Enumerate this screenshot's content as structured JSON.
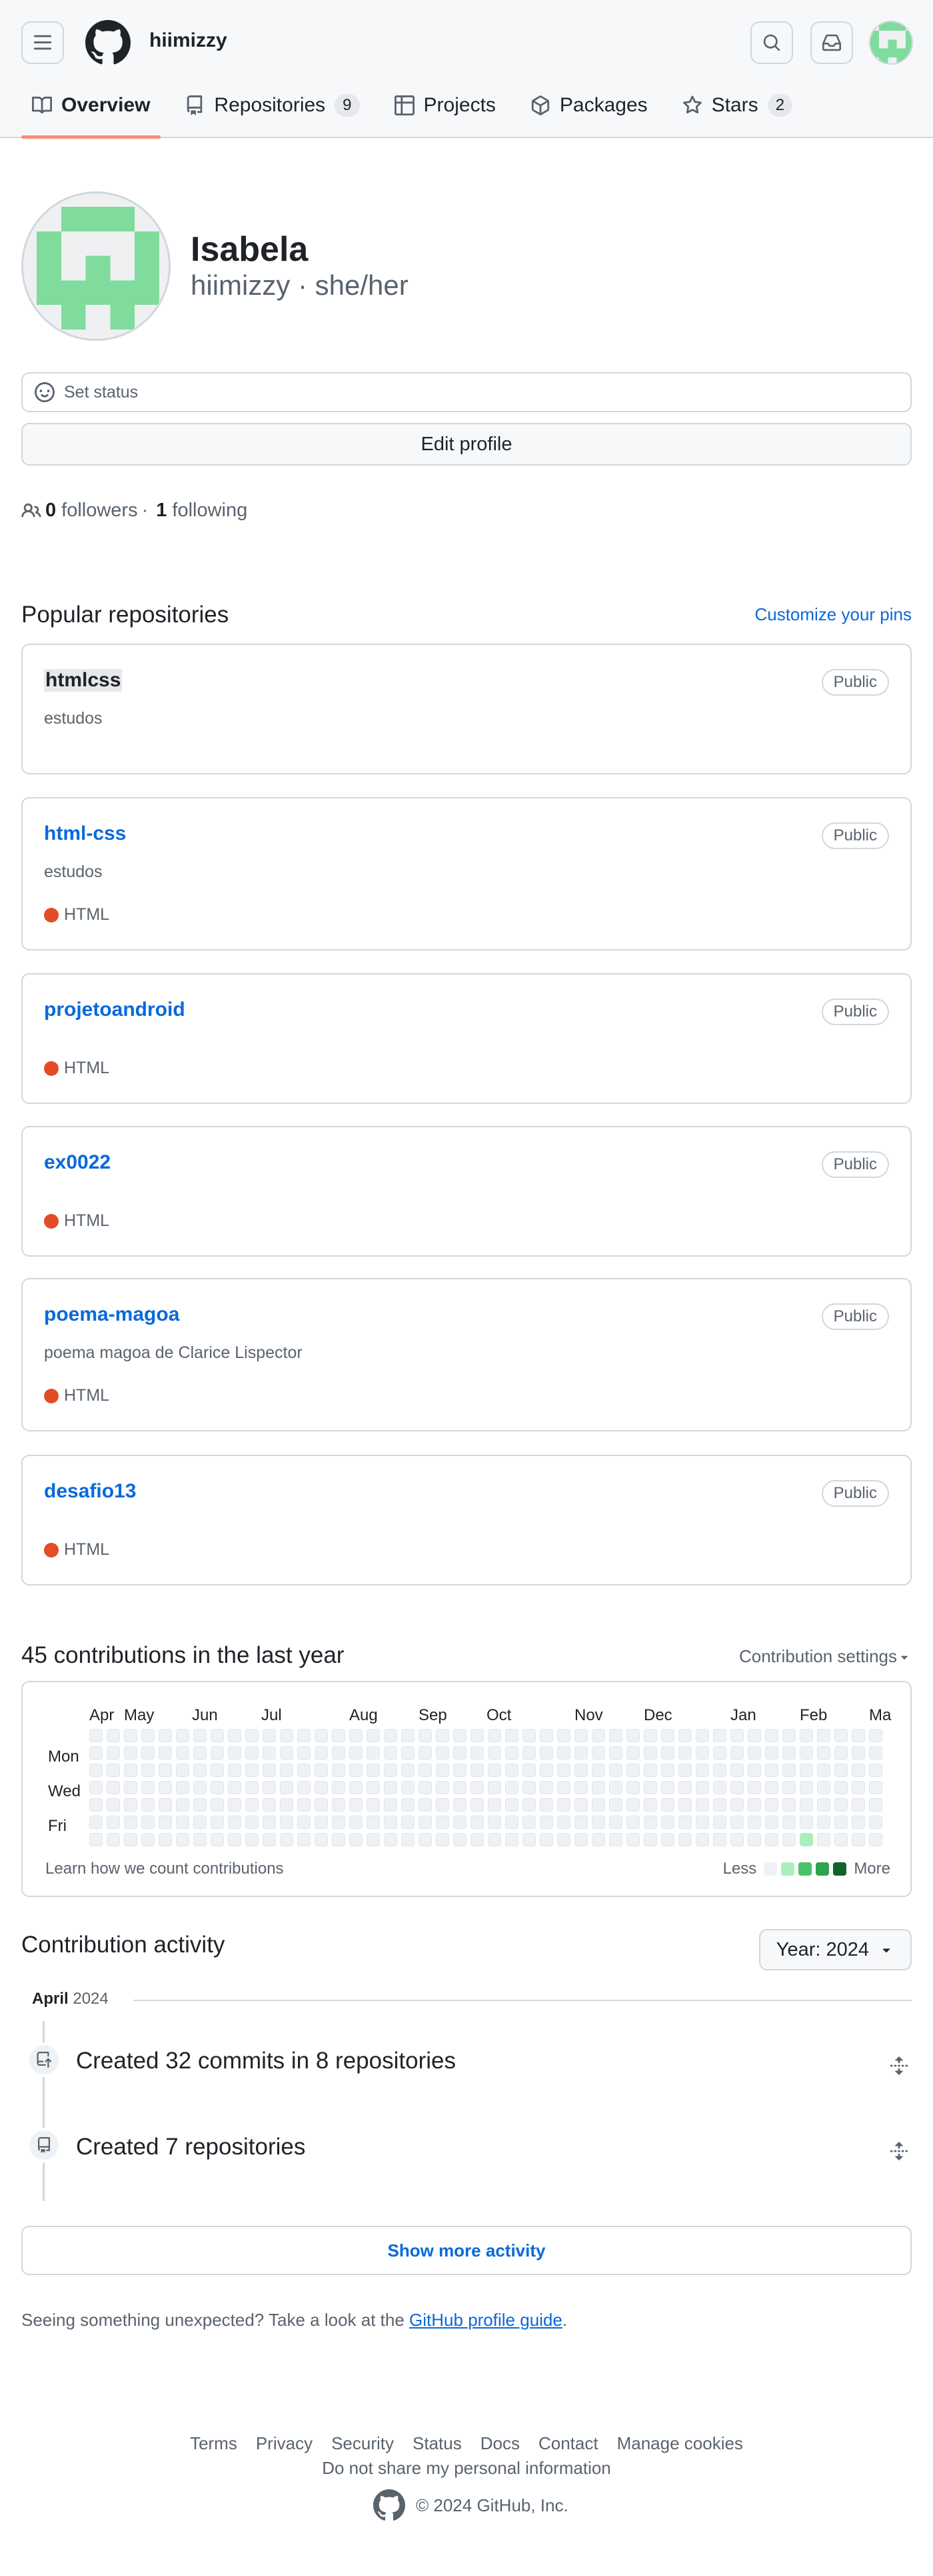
{
  "header": {
    "username": "hiimizzy",
    "tabs": [
      {
        "label": "Overview",
        "icon": "book-icon",
        "active": true
      },
      {
        "label": "Repositories",
        "icon": "repo-icon",
        "count": "9"
      },
      {
        "label": "Projects",
        "icon": "table-icon"
      },
      {
        "label": "Packages",
        "icon": "package-icon"
      },
      {
        "label": "Stars",
        "icon": "star-icon",
        "count": "2"
      }
    ]
  },
  "profile": {
    "name": "Isabela",
    "login_pronouns": "hiimizzy · she/her",
    "status_placeholder": "Set status",
    "edit_label": "Edit profile",
    "followers_count": "0",
    "followers_label": "followers",
    "separator": "·",
    "following_count": "1",
    "following_label": "following",
    "avatar_color": "#7fdc9c"
  },
  "popular": {
    "title": "Popular repositories",
    "customize": "Customize your pins",
    "repos": [
      {
        "name": "htmlcss",
        "visibility": "Public",
        "description": "estudos",
        "language": ""
      },
      {
        "name": "html-css",
        "visibility": "Public",
        "description": "estudos",
        "language": "HTML"
      },
      {
        "name": "projetoandroid",
        "visibility": "Public",
        "description": "",
        "language": "HTML"
      },
      {
        "name": "ex0022",
        "visibility": "Public",
        "description": "",
        "language": "HTML"
      },
      {
        "name": "poema-magoa",
        "visibility": "Public",
        "description": "poema magoa de Clarice Lispector",
        "language": "HTML"
      },
      {
        "name": "desafio13",
        "visibility": "Public",
        "description": "",
        "language": "HTML"
      }
    ],
    "language_color": "#e34c26"
  },
  "contributions": {
    "title": "45 contributions in the last year",
    "settings": "Contribution settings",
    "months": [
      "Apr",
      "May",
      "Jun",
      "Jul",
      "Aug",
      "Sep",
      "Oct",
      "Nov",
      "Dec",
      "Jan",
      "Feb",
      "Ma"
    ],
    "day_labels": [
      "Mon",
      "Wed",
      "Fri"
    ],
    "learn": "Learn how we count contributions",
    "legend_less": "Less",
    "legend_more": "More",
    "legend_colors": [
      "#eff2f5",
      "#aceebb",
      "#4ac26b",
      "#2da44e",
      "#116329"
    ],
    "active_cells": [
      {
        "week": 41,
        "day": 6,
        "level": 1
      }
    ]
  },
  "activity": {
    "title": "Contribution activity",
    "year_button": "Year: 2024",
    "month": "April",
    "year": "2024",
    "items": [
      {
        "text": "Created 32 commits in 8 repositories",
        "icon": "repo-push-icon"
      },
      {
        "text": "Created 7 repositories",
        "icon": "repo-icon"
      }
    ],
    "show_more": "Show more activity"
  },
  "unexpected": {
    "text": "Seeing something unexpected? Take a look at the ",
    "link": "GitHub profile guide",
    "end": "."
  },
  "footer": {
    "links": [
      "Terms",
      "Privacy",
      "Security",
      "Status",
      "Docs",
      "Contact",
      "Manage cookies"
    ],
    "do_not_share": "Do not share my personal information",
    "copyright": "© 2024 GitHub, Inc."
  }
}
